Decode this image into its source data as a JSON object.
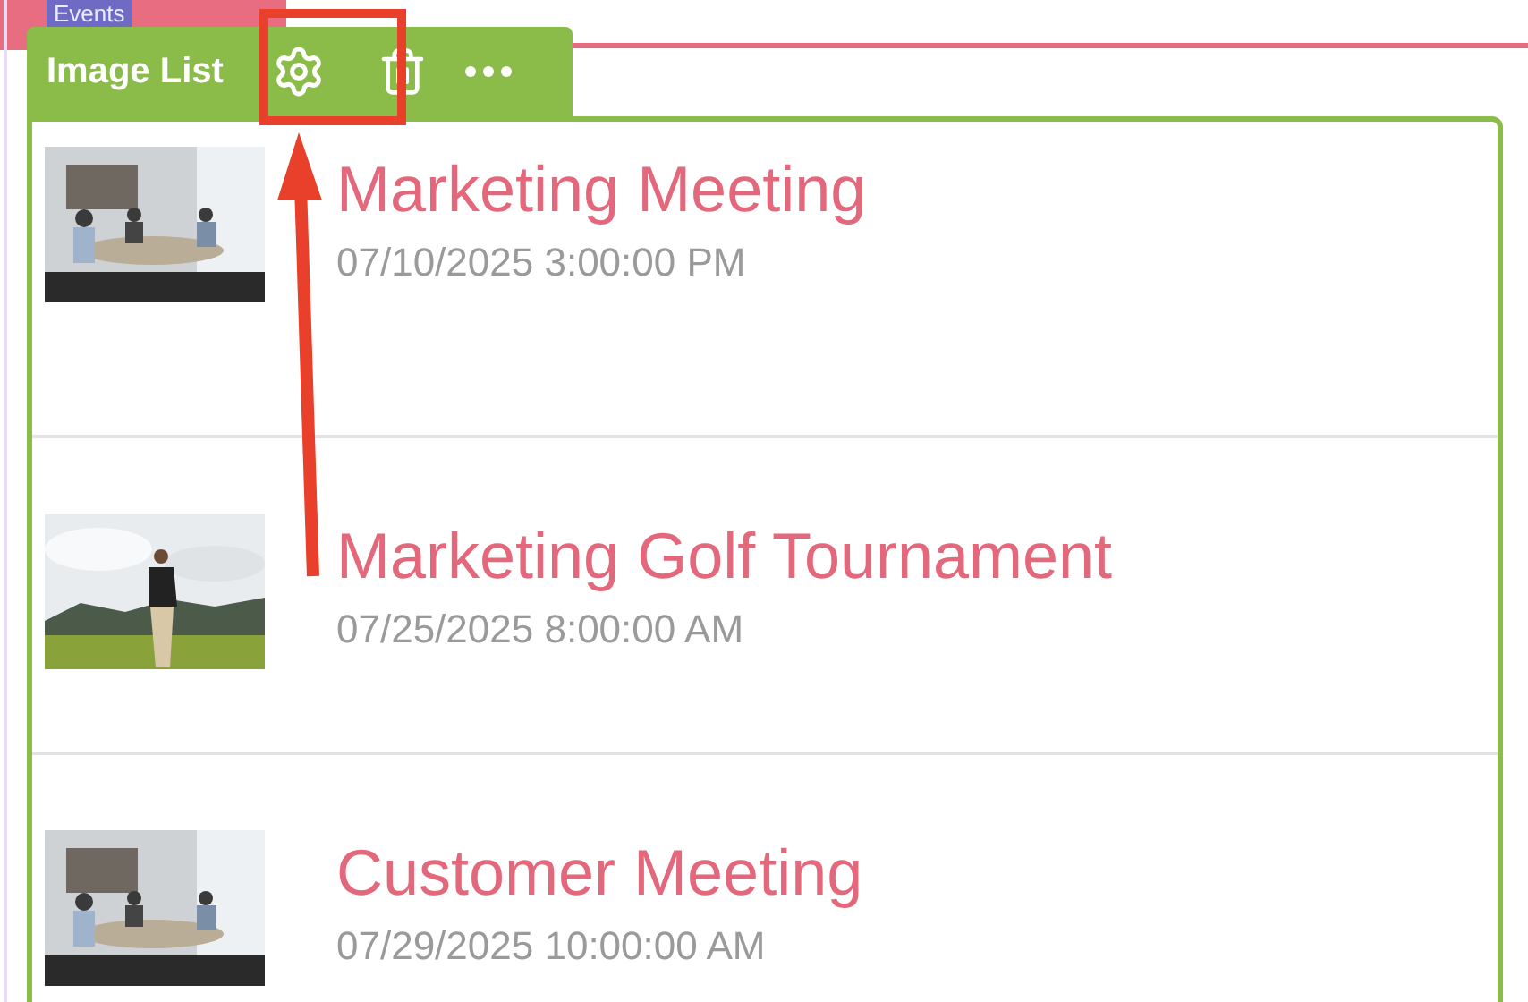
{
  "header": {
    "title": "Events"
  },
  "toolbar": {
    "label": "Image List"
  },
  "items": [
    {
      "title": "Marketing Meeting",
      "date": "07/10/2025 3:00:00 PM",
      "kind": "meeting"
    },
    {
      "title": "Marketing Golf Tournament",
      "date": "07/25/2025 8:00:00 AM",
      "kind": "golf"
    },
    {
      "title": "Customer Meeting",
      "date": "07/29/2025 10:00:00 AM",
      "kind": "meeting"
    }
  ]
}
